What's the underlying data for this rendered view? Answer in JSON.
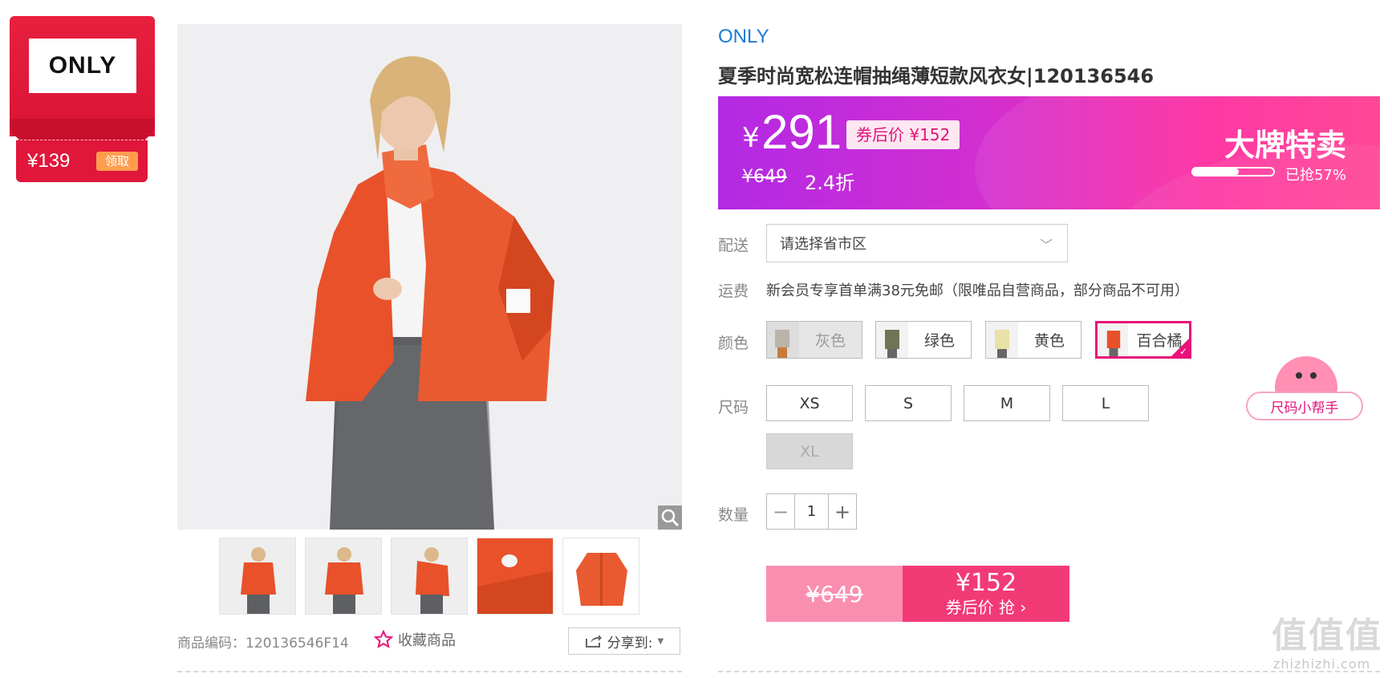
{
  "brand_badge": {
    "logo_text": "ONLY",
    "coupon_price": "¥139",
    "coupon_button": "领取"
  },
  "gallery": {
    "thumbnails": [
      "product-front",
      "product-front-2",
      "product-side",
      "product-detail",
      "product-flat"
    ]
  },
  "meta": {
    "sku_label": "商品编码：120136546F14",
    "favorite_label": "收藏商品",
    "share_label": "分享到:"
  },
  "product": {
    "brand": "ONLY",
    "title": "夏季时尚宽松连帽抽绳薄短款风衣女|120136546"
  },
  "price_banner": {
    "currency": "¥",
    "price": "291",
    "coupon_tag": "券后价 ¥152",
    "original_price": "¥649",
    "discount": "2.4折",
    "sale_title": "大牌特卖",
    "sold_fraction": 0.57,
    "sold_text": "已抢57%"
  },
  "delivery": {
    "label": "配送",
    "select_value": "请选择省市区"
  },
  "shipping": {
    "label": "运费",
    "text": "新会员专享首单满38元免邮（限唯品自营商品，部分商品不可用）"
  },
  "colors": {
    "label": "颜色",
    "options": [
      {
        "name": "灰色",
        "state": "disabled"
      },
      {
        "name": "绿色",
        "state": "normal"
      },
      {
        "name": "黄色",
        "state": "normal"
      },
      {
        "name": "百合橘",
        "state": "selected"
      }
    ]
  },
  "sizes": {
    "label": "尺码",
    "options": [
      {
        "name": "XS",
        "state": "normal"
      },
      {
        "name": "S",
        "state": "normal"
      },
      {
        "name": "M",
        "state": "normal"
      },
      {
        "name": "L",
        "state": "normal"
      },
      {
        "name": "XL",
        "state": "disabled"
      }
    ]
  },
  "size_helper": {
    "label": "尺码小帮手"
  },
  "quantity": {
    "label": "数量",
    "value": "1",
    "minus": "−",
    "plus": "+"
  },
  "buy": {
    "original_price": "¥649",
    "coupon_price": "¥152",
    "action_text": "券后价 抢 ›"
  },
  "watermark": {
    "big": "值值值",
    "small": "zhizhizhi.com"
  },
  "colors_theme": {
    "accent_pink": "#e8137a",
    "brand_red": "#e0173a",
    "link_blue": "#1a7bd8"
  }
}
